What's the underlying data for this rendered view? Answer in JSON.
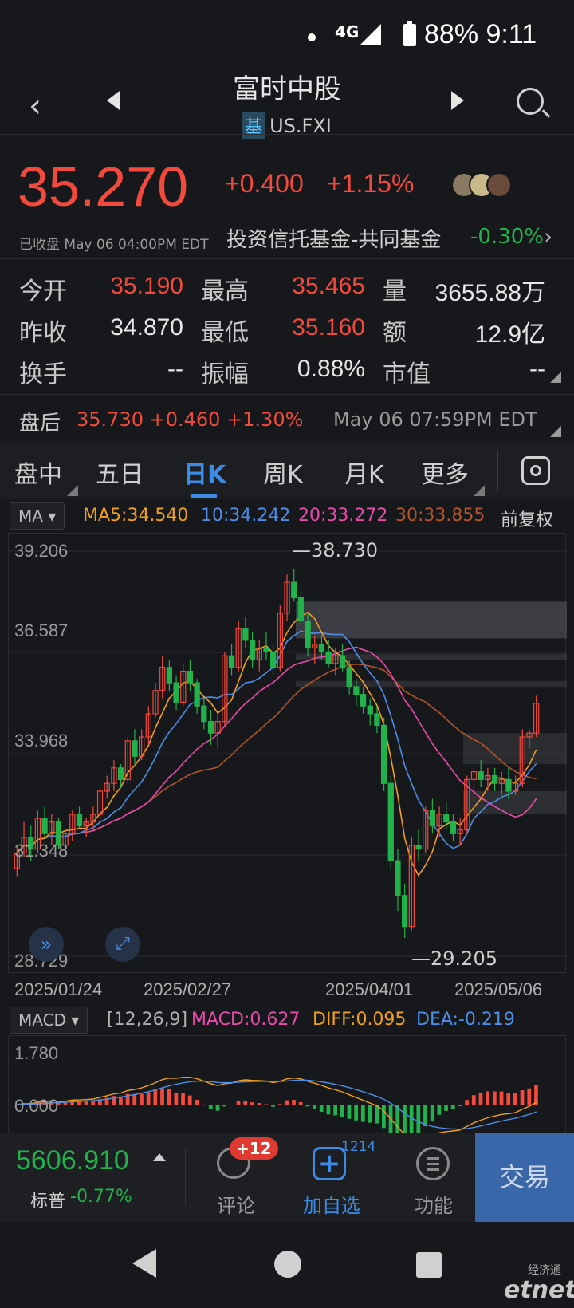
{
  "status_bar": {
    "network": "4G",
    "battery": "88%",
    "time": "9:11",
    "battery_time": "88% 9:11"
  },
  "header": {
    "title": "富时中股",
    "badge": "基",
    "symbol": "US.FXI"
  },
  "quote": {
    "price": "35.270",
    "change": "+0.400",
    "change_pct": "+1.15%",
    "closed_label": "已收盘 May 06 04:00PM EDT",
    "sector_name": "投资信托基金-共同基金",
    "sector_pct": "-0.30%"
  },
  "stats": {
    "open_label": "今开",
    "open": "35.190",
    "high_label": "最高",
    "high": "35.465",
    "volume_label": "量",
    "volume": "3655.88万",
    "prev_label": "昨收",
    "prev": "34.870",
    "low_label": "最低",
    "low": "35.160",
    "amount_label": "额",
    "amount": "12.9亿",
    "turnover_label": "换手",
    "turnover": "--",
    "amplitude_label": "振幅",
    "amplitude": "0.88%",
    "mktcap_label": "市值",
    "mktcap": "--"
  },
  "after_hours": {
    "label": "盘后",
    "value": "35.730 +0.460 +1.30%",
    "time": "May 06 07:59PM EDT"
  },
  "tabs": [
    "盘中",
    "五日",
    "日K",
    "周K",
    "月K",
    "更多"
  ],
  "active_tab": 2,
  "indicator": {
    "ma_selector": "MA",
    "ma5": "MA5:34.540",
    "ma10": "10:34.242",
    "ma20": "20:33.272",
    "ma30": "30:33.855",
    "adjust": "前复权",
    "macd_selector": "MACD",
    "macd_params": "[12,26,9]",
    "macd": "MACD:0.627",
    "diff": "DIFF:0.095",
    "dea": "DEA:-0.219"
  },
  "colors": {
    "up": "#f24a3c",
    "down": "#22b24c",
    "ma5": "#f0a020",
    "ma10": "#4d8ee8",
    "ma20": "#e84caa",
    "ma30": "#b4542a",
    "accent": "#3c8ce6"
  },
  "chart_data": {
    "type": "candlestick",
    "y_ticks": [
      "39.206",
      "36.587",
      "33.968",
      "31.348",
      "28.729"
    ],
    "ylim": [
      28.729,
      39.206
    ],
    "x_ticks": [
      "2025/01/24",
      "2025/02/27",
      "2025/04/01",
      "2025/05/06"
    ],
    "high_mark": "38.730",
    "low_mark": "29.205",
    "ohlc": [
      [
        31.0,
        31.6,
        30.8,
        31.4
      ],
      [
        31.4,
        32.2,
        31.3,
        31.8
      ],
      [
        31.8,
        32.1,
        31.2,
        31.5
      ],
      [
        31.5,
        32.5,
        31.4,
        32.3
      ],
      [
        32.3,
        32.6,
        31.8,
        31.9
      ],
      [
        31.9,
        32.4,
        31.6,
        32.2
      ],
      [
        32.2,
        32.3,
        31.5,
        31.6
      ],
      [
        31.6,
        32.0,
        31.3,
        31.9
      ],
      [
        31.9,
        32.5,
        31.7,
        32.4
      ],
      [
        32.4,
        32.6,
        32.0,
        32.1
      ],
      [
        32.1,
        32.3,
        31.8,
        32.2
      ],
      [
        32.2,
        32.6,
        32.0,
        32.4
      ],
      [
        32.4,
        33.1,
        32.2,
        33.0
      ],
      [
        33.0,
        33.4,
        32.8,
        33.2
      ],
      [
        33.2,
        33.8,
        33.0,
        33.6
      ],
      [
        33.6,
        33.7,
        33.1,
        33.3
      ],
      [
        33.3,
        34.4,
        33.2,
        34.3
      ],
      [
        34.3,
        34.6,
        33.7,
        33.9
      ],
      [
        33.9,
        34.6,
        33.8,
        34.4
      ],
      [
        34.4,
        35.2,
        34.2,
        35.0
      ],
      [
        35.0,
        35.8,
        34.9,
        35.6
      ],
      [
        35.6,
        36.5,
        35.4,
        36.2
      ],
      [
        36.2,
        36.4,
        35.6,
        35.8
      ],
      [
        35.8,
        36.0,
        35.1,
        35.3
      ],
      [
        35.3,
        36.3,
        35.2,
        36.1
      ],
      [
        36.1,
        36.4,
        35.6,
        35.8
      ],
      [
        35.8,
        35.9,
        35.0,
        35.2
      ],
      [
        35.2,
        35.4,
        34.6,
        34.8
      ],
      [
        34.8,
        35.1,
        34.2,
        34.5
      ],
      [
        34.5,
        35.0,
        34.1,
        34.8
      ],
      [
        34.8,
        36.6,
        34.7,
        36.5
      ],
      [
        36.5,
        36.8,
        36.0,
        36.2
      ],
      [
        36.2,
        37.4,
        36.1,
        37.2
      ],
      [
        37.2,
        37.5,
        36.7,
        36.9
      ],
      [
        36.9,
        37.1,
        36.2,
        36.4
      ],
      [
        36.4,
        36.9,
        36.1,
        36.7
      ],
      [
        36.7,
        37.1,
        36.4,
        36.6
      ],
      [
        36.6,
        36.8,
        36.0,
        36.2
      ],
      [
        36.2,
        37.8,
        36.1,
        37.6
      ],
      [
        37.6,
        38.6,
        37.4,
        38.4
      ],
      [
        38.4,
        38.73,
        37.9,
        38.0
      ],
      [
        38.0,
        38.2,
        37.3,
        37.4
      ],
      [
        37.4,
        37.6,
        36.5,
        36.7
      ],
      [
        36.7,
        37.0,
        36.3,
        36.8
      ],
      [
        36.8,
        37.0,
        36.4,
        36.6
      ],
      [
        36.6,
        36.9,
        36.2,
        36.3
      ],
      [
        36.3,
        36.7,
        36.0,
        36.5
      ],
      [
        36.5,
        36.8,
        36.1,
        36.2
      ],
      [
        36.2,
        36.4,
        35.5,
        35.7
      ],
      [
        35.7,
        35.9,
        35.2,
        35.5
      ],
      [
        35.5,
        35.7,
        35.0,
        35.2
      ],
      [
        35.2,
        35.4,
        34.7,
        35.0
      ],
      [
        35.0,
        35.2,
        34.5,
        34.7
      ],
      [
        34.7,
        34.9,
        33.0,
        33.2
      ],
      [
        33.2,
        33.4,
        31.0,
        31.2
      ],
      [
        31.2,
        31.5,
        29.9,
        30.3
      ],
      [
        30.3,
        30.6,
        29.205,
        29.5
      ],
      [
        29.5,
        31.8,
        29.4,
        31.6
      ],
      [
        31.6,
        32.0,
        31.2,
        31.5
      ],
      [
        31.5,
        32.6,
        31.4,
        32.5
      ],
      [
        32.5,
        32.8,
        31.9,
        32.1
      ],
      [
        32.1,
        32.6,
        31.8,
        32.4
      ],
      [
        32.4,
        32.7,
        32.0,
        32.2
      ],
      [
        32.2,
        32.4,
        31.7,
        31.9
      ],
      [
        31.9,
        32.3,
        31.6,
        32.0
      ],
      [
        32.0,
        33.4,
        31.9,
        33.3
      ],
      [
        33.3,
        33.6,
        32.9,
        33.5
      ],
      [
        33.5,
        33.8,
        33.1,
        33.3
      ],
      [
        33.3,
        33.6,
        33.0,
        33.4
      ],
      [
        33.4,
        33.6,
        33.0,
        33.2
      ],
      [
        33.2,
        33.5,
        32.9,
        33.3
      ],
      [
        33.3,
        33.6,
        32.8,
        33.0
      ],
      [
        33.0,
        33.4,
        32.9,
        33.2
      ],
      [
        33.2,
        34.6,
        33.1,
        34.4
      ],
      [
        34.4,
        34.6,
        34.1,
        34.5
      ],
      [
        34.5,
        35.465,
        34.4,
        35.27
      ]
    ]
  },
  "macd_chart": {
    "y_ticks": [
      "1.780",
      "0.000"
    ]
  },
  "bottom_bar": {
    "index_value": "5606.910",
    "index_name": "标普",
    "index_pct": "-0.77%",
    "comment_badge": "+12",
    "comment": "评论",
    "watch_count": "1214",
    "watch": "加自选",
    "function": "功能",
    "trade": "交易"
  },
  "watermark": {
    "text": "etnet",
    "cn": "经济通"
  }
}
